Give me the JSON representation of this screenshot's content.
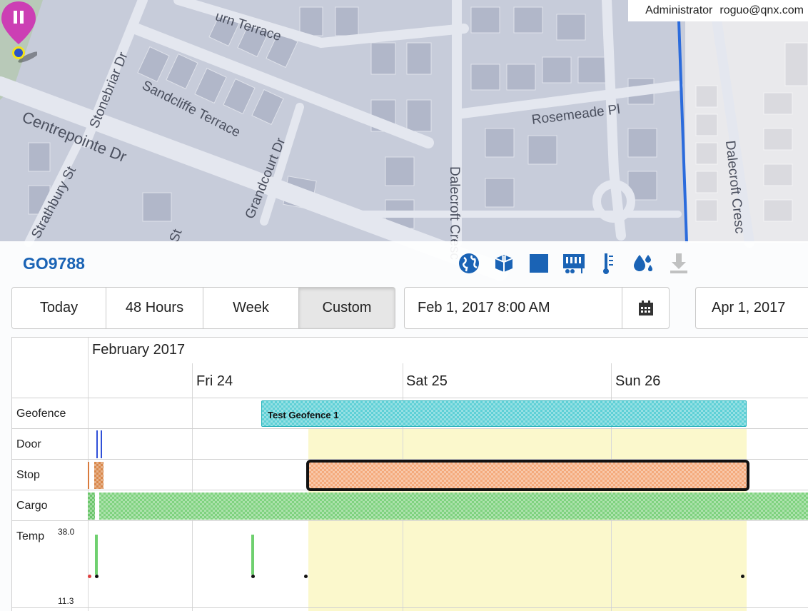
{
  "user": {
    "role": "Administrator",
    "email": "roguo@qnx.com"
  },
  "map": {
    "streets": [
      "Sandcliffe Terrace",
      "Centrepointe Dr",
      "Stonebriar Dr",
      "Grandcourt Dr",
      "Rosemeade Pl",
      "Dalecroft Cresc",
      "Strathbury St",
      "urn Terrace",
      "St",
      "Dalecroft Cresc"
    ]
  },
  "asset": {
    "name": "GO9788"
  },
  "toolbar": {
    "icons": [
      "globe-icon",
      "package-icon",
      "square-icon",
      "trailer-icon",
      "thermometer-icon",
      "humidity-icon",
      "download-icon"
    ],
    "colors": {
      "icon": "#1a63b5",
      "title": "#1a63b5"
    }
  },
  "range": {
    "tabs": [
      "Today",
      "48 Hours",
      "Week",
      "Custom"
    ],
    "active": "Custom",
    "start": "Feb 1, 2017 8:00 AM",
    "end": "Apr 1, 2017"
  },
  "timeline": {
    "month": "February 2017",
    "days": [
      "Fri 24",
      "Sat 25",
      "Sun 26"
    ],
    "rows": [
      "Geofence",
      "Door",
      "Stop",
      "Cargo",
      "Temp"
    ],
    "geofence_label": "Test Geofence 1",
    "temp_max": "38.0",
    "temp_min": "11.3",
    "colors": {
      "geofence": "#5ed0d6",
      "stop": "#f4aa7c",
      "cargo": "#7fd27f",
      "door": "#3050d8",
      "highlight": "#fbf8cc"
    }
  }
}
